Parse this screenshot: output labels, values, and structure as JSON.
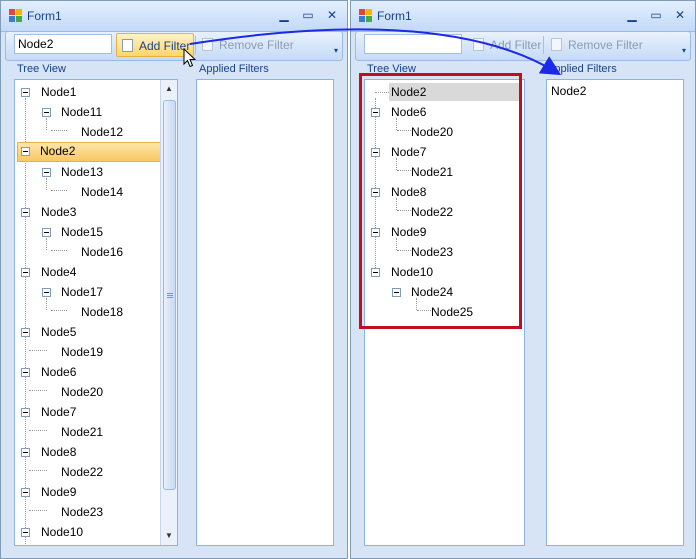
{
  "window_left": {
    "title": "Form1",
    "toolbar": {
      "filter_text": "Node2",
      "add_filter_label": "Add Filter",
      "remove_filter_label": "Remove Filter"
    },
    "tree_label": "Tree View",
    "filters_label": "Applied Filters",
    "tree_nodes": [
      "Node1",
      "Node11",
      "Node12",
      "Node2",
      "Node13",
      "Node14",
      "Node3",
      "Node15",
      "Node16",
      "Node4",
      "Node17",
      "Node18",
      "Node5",
      "Node19",
      "Node6",
      "Node20",
      "Node7",
      "Node21",
      "Node8",
      "Node22",
      "Node9",
      "Node23",
      "Node10"
    ],
    "applied_filters": []
  },
  "window_right": {
    "title": "Form1",
    "toolbar": {
      "filter_text": "",
      "add_filter_label": "Add Filter",
      "remove_filter_label": "Remove Filter"
    },
    "tree_label": "Tree View",
    "filters_label": "Applied Filters",
    "tree_nodes": [
      "Node2",
      "Node6",
      "Node20",
      "Node7",
      "Node21",
      "Node8",
      "Node22",
      "Node9",
      "Node23",
      "Node10",
      "Node24",
      "Node25"
    ],
    "applied_filters": [
      "Node2"
    ]
  },
  "colors": {
    "highlight_box": "#c0101e",
    "arrow": "#1a2ae6",
    "selection": "#f9c864"
  },
  "icons": [
    "app-icon",
    "minimize-icon",
    "maximize-icon",
    "close-icon",
    "document-icon",
    "expand-icon",
    "scroll-up-arrow-icon",
    "scroll-down-arrow-icon"
  ]
}
